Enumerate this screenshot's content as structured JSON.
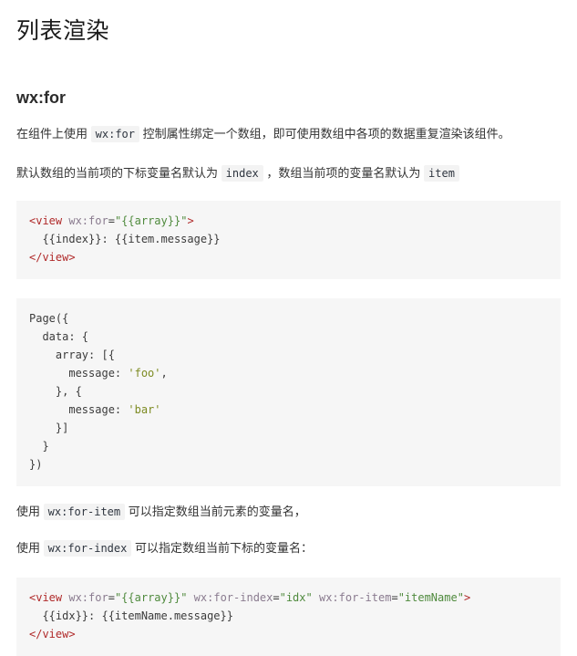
{
  "page": {
    "title": "列表渲染",
    "section_title": "wx:for"
  },
  "paragraphs": {
    "intro_a": "在组件上使用",
    "intro_code": "wx:for",
    "intro_b": "控制属性绑定一个数组，即可使用数组中各项的数据重复渲染该组件。",
    "defaults_a": "默认数组的当前项的下标变量名默认为",
    "defaults_code1": "index",
    "defaults_b": "，数组当前项的变量名默认为",
    "defaults_code2": "item",
    "foritem_a": "使用",
    "foritem_code": "wx:for-item",
    "foritem_b": "可以指定数组当前元素的变量名，",
    "forindex_a": "使用",
    "forindex_code": "wx:for-index",
    "forindex_b": "可以指定数组当前下标的变量名："
  },
  "code_block_1": {
    "language": "wxml",
    "line1_tag_open": "<view ",
    "line1_attr": "wx:for",
    "line1_eq": "=",
    "line1_str": "\"{{array}}\"",
    "line1_close": ">",
    "line2": "  {{index}}: {{item.message}}",
    "line3_tag_close": "</view>",
    "plain_text": "<view wx:for=\"{{array}}\">\n  {{index}}: {{item.message}}\n</view>"
  },
  "code_block_2": {
    "language": "javascript",
    "lines": [
      "Page({",
      "  data: {",
      "    array: [{",
      "      message: 'foo',",
      "    }, {",
      "      message: 'bar'",
      "    }]",
      "  }",
      "})"
    ],
    "string_foo": "'foo'",
    "string_bar": "'bar'",
    "l1": "Page({",
    "l2": "  data: {",
    "l3": "    array: [{",
    "l4_pre": "      message: ",
    "l4_post": ",",
    "l5": "    }, {",
    "l6_pre": "      message: ",
    "l7": "    }]",
    "l8": "  }",
    "l9": "})"
  },
  "code_block_3": {
    "language": "wxml",
    "line1_tag_open": "<view ",
    "line1_attr1": "wx:for",
    "line1_str1": "\"{{array}}\"",
    "line1_attr2": "wx:for-index",
    "line1_str2": "\"idx\"",
    "line1_attr3": "wx:for-item",
    "line1_str3": "\"itemName\"",
    "line1_close": ">",
    "eq": "=",
    "space": " ",
    "line2": "  {{idx}}: {{itemName.message}}",
    "line3_tag_close": "</view>",
    "plain_text": "<view wx:for=\"{{array}}\" wx:for-index=\"idx\" wx:for-item=\"itemName\">\n  {{idx}}: {{itemName.message}}\n</view>"
  },
  "colors": {
    "background": "#ffffff",
    "text": "#333333",
    "code_block_bg": "#f6f6f6",
    "inline_code_bg": "#f3f3f3",
    "tag_color": "#b02a2a",
    "attr_color": "#8a7b8f",
    "string_color": "#4f8a3d",
    "js_string_color": "#7d8b22"
  }
}
